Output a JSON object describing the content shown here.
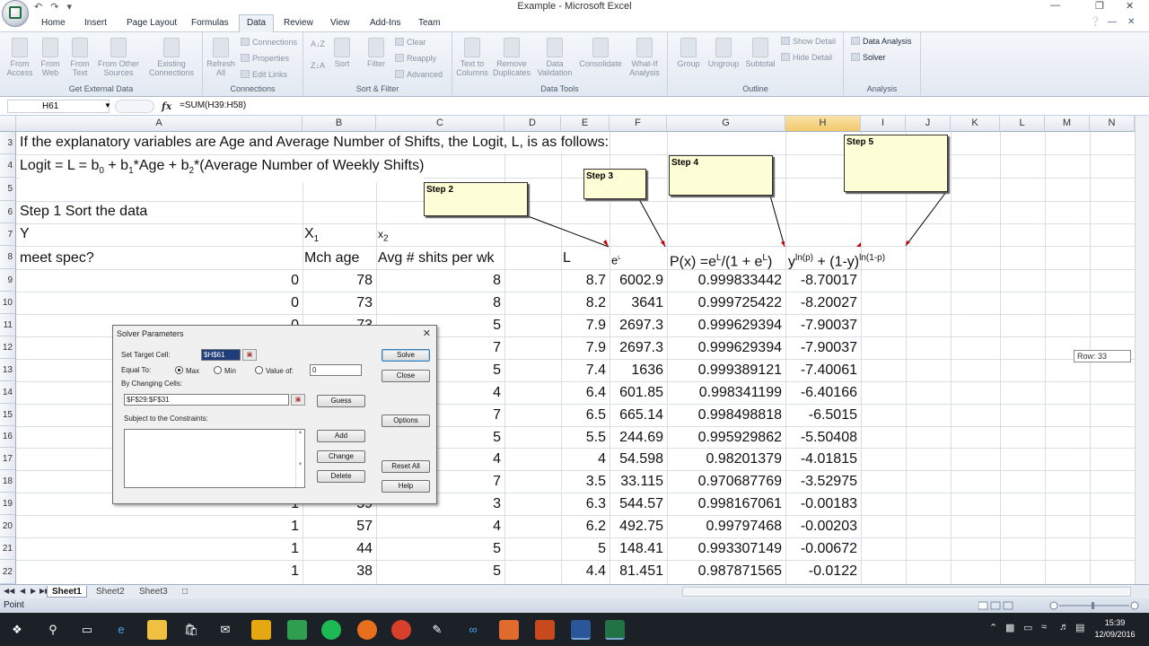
{
  "window": {
    "title": "Example - Microsoft Excel",
    "qat": "↶ ↷ ▾"
  },
  "tabs": [
    "Home",
    "Insert",
    "Page Layout",
    "Formulas",
    "Data",
    "Review",
    "View",
    "Add-Ins",
    "Team"
  ],
  "ribbon": {
    "get_external": {
      "label": "Get External Data",
      "items": [
        "From Access",
        "From Web",
        "From Text",
        "From Other Sources",
        "Existing Connections"
      ]
    },
    "connections": {
      "label": "Connections",
      "refresh": "Refresh All",
      "items": [
        "Connections",
        "Properties",
        "Edit Links"
      ]
    },
    "sort_filter": {
      "label": "Sort & Filter",
      "sort": "Sort",
      "filter": "Filter",
      "items": [
        "Clear",
        "Reapply",
        "Advanced"
      ]
    },
    "data_tools": {
      "label": "Data Tools",
      "items": [
        "Text to Columns",
        "Remove Duplicates",
        "Data Validation",
        "Consolidate",
        "What-If Analysis"
      ]
    },
    "outline": {
      "label": "Outline",
      "items": [
        "Group",
        "Ungroup",
        "Subtotal"
      ],
      "show_detail": "Show Detail",
      "hide_detail": "Hide Detail"
    },
    "analysis": {
      "label": "Analysis",
      "data_analysis": "Data Analysis",
      "solver": "Solver"
    }
  },
  "formula_bar": {
    "name_box": "H61",
    "fx": "fx",
    "formula": "=SUM(H39:H58)"
  },
  "columns": [
    "A",
    "B",
    "C",
    "D",
    "E",
    "F",
    "G",
    "H",
    "I",
    "J",
    "K",
    "L",
    "M",
    "N"
  ],
  "rows": [
    {
      "num": "3",
      "a": "If the explanatory variables are Age and Average Number of Shifts, the Logit, L, is as follows:"
    },
    {
      "num": "4",
      "a": "Logit = L = b",
      "a_sub0": "0",
      "a_mid1": " + b",
      "a_sub1": "1",
      "a_mid2": "*Age + b",
      "a_sub2": "2",
      "a_end": "*(Average Number of Weekly Shifts)"
    },
    {
      "num": "5"
    },
    {
      "num": "6",
      "a": "Step 1 Sort the data"
    },
    {
      "num": "7",
      "a": "Y",
      "b": "X",
      "b_sub": "1",
      "c": "x",
      "c_sub": "2"
    },
    {
      "num": "8",
      "a": "meet spec?",
      "b": "Mch age",
      "c": "Avg # shits per wk",
      "e": "L",
      "f": "e",
      "f_sup": "L",
      "g1": "P(x) =e",
      "g_sup1": "L",
      "g2": "/(1 + e",
      "g_sup2": "L",
      "g3": ")",
      "h1": "y",
      "h_sup": "ln(p)",
      "h2": " + (1-y)",
      "h_sup2": "ln(1-p)"
    },
    {
      "num": "9",
      "a": "0",
      "b": "78",
      "c": "8",
      "e": "8.7",
      "f": "6002.9",
      "g": "0.999833442",
      "h": "-8.70017"
    },
    {
      "num": "10",
      "a": "0",
      "b": "73",
      "c": "8",
      "e": "8.2",
      "f": "3641",
      "g": "0.999725422",
      "h": "-8.20027"
    },
    {
      "num": "11",
      "a": "0",
      "b": "73",
      "c": "5",
      "e": "7.9",
      "f": "2697.3",
      "g": "0.999629394",
      "h": "-7.90037"
    },
    {
      "num": "12",
      "a": "",
      "b": "",
      "c": "7",
      "e": "7.9",
      "f": "2697.3",
      "g": "0.999629394",
      "h": "-7.90037"
    },
    {
      "num": "13",
      "a": "",
      "b": "",
      "c": "5",
      "e": "7.4",
      "f": "1636",
      "g": "0.999389121",
      "h": "-7.40061"
    },
    {
      "num": "14",
      "a": "",
      "b": "",
      "c": "4",
      "e": "6.4",
      "f": "601.85",
      "g": "0.998341199",
      "h": "-6.40166"
    },
    {
      "num": "15",
      "a": "",
      "b": "",
      "c": "7",
      "e": "6.5",
      "f": "665.14",
      "g": "0.998498818",
      "h": "-6.5015"
    },
    {
      "num": "16",
      "a": "",
      "b": "",
      "c": "5",
      "e": "5.5",
      "f": "244.69",
      "g": "0.995929862",
      "h": "-5.50408"
    },
    {
      "num": "17",
      "a": "",
      "b": "",
      "c": "4",
      "e": "4",
      "f": "54.598",
      "g": "0.98201379",
      "h": "-4.01815"
    },
    {
      "num": "18",
      "a": "",
      "b": "",
      "c": "7",
      "e": "3.5",
      "f": "33.115",
      "g": "0.970687769",
      "h": "-3.52975"
    },
    {
      "num": "19",
      "a": "1",
      "b": "59",
      "c": "3",
      "e": "6.3",
      "f": "544.57",
      "g": "0.998167061",
      "h": "-0.00183"
    },
    {
      "num": "20",
      "a": "1",
      "b": "57",
      "c": "4",
      "e": "6.2",
      "f": "492.75",
      "g": "0.99797468",
      "h": "-0.00203"
    },
    {
      "num": "21",
      "a": "1",
      "b": "44",
      "c": "5",
      "e": "5",
      "f": "148.41",
      "g": "0.993307149",
      "h": "-0.00672"
    },
    {
      "num": "22",
      "a": "1",
      "b": "38",
      "c": "5",
      "e": "4.4",
      "f": "81.451",
      "g": "0.987871565",
      "h": "-0.0122"
    }
  ],
  "notes": {
    "step2": "Step 2",
    "step3": "Step 3",
    "step4": "Step 4",
    "step5": "Step 5"
  },
  "row_tooltip": "Row: 33",
  "solver": {
    "title": "Solver Parameters",
    "close": "✕",
    "set_target_label": "Set Target Cell:",
    "set_target_value": "$H$61",
    "equal_to_label": "Equal To:",
    "max": "Max",
    "min": "Min",
    "value_of": "Value of:",
    "value": "0",
    "by_changing_label": "By Changing Cells:",
    "by_changing_value": "$F$29:$F$31",
    "constraints_label": "Subject to the Constraints:",
    "buttons": {
      "solve": "Solve",
      "close": "Close",
      "guess": "Guess",
      "options": "Options",
      "add": "Add",
      "change": "Change",
      "delete": "Delete",
      "reset_all": "Reset All",
      "help": "Help"
    }
  },
  "sheets": [
    "Sheet1",
    "Sheet2",
    "Sheet3"
  ],
  "status": "Point",
  "clock": {
    "time": "15:39",
    "date": "12/09/2016"
  }
}
